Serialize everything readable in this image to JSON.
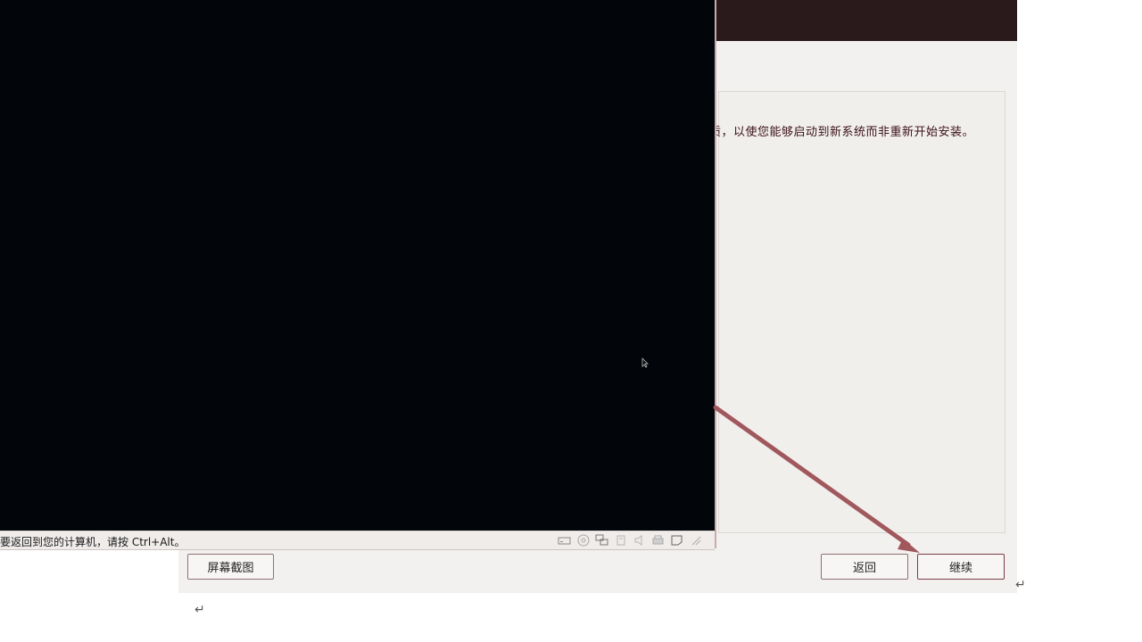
{
  "installer": {
    "body_text": "质，以使您能够启动到新系统而非重新开始安装。"
  },
  "vm": {
    "status_text": "要返回到您的计算机，请按 Ctrl+Alt。",
    "status_icons": [
      "hard-disk-icon",
      "optical-drive-icon",
      "network-icon",
      "usb-icon",
      "audio-icon",
      "printer-icon",
      "message-icon",
      "resize-grip-icon"
    ]
  },
  "buttons": {
    "screenshot_label": "屏幕截图",
    "back_label": "返回",
    "continue_label": "继续"
  },
  "document": {
    "paragraph_mark": "↵"
  },
  "colors": {
    "vm_background": "#02060a",
    "header_dark": "#2b1a1c",
    "annotation_arrow": "#a0585c"
  }
}
